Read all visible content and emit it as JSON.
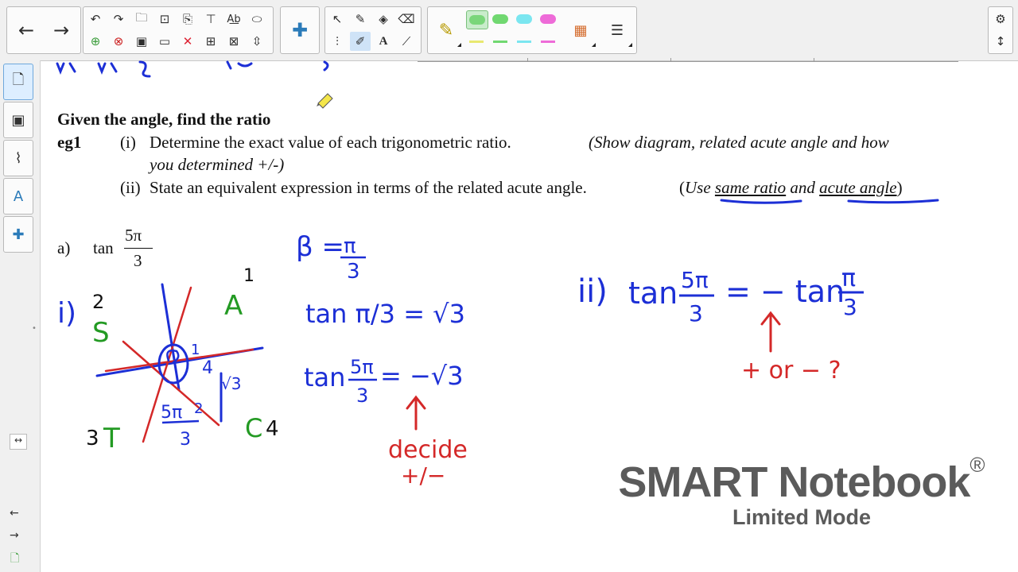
{
  "toolbar": {
    "nav": {
      "back_icon": "left-arrow-icon",
      "forward_icon": "right-arrow-icon"
    },
    "colors": [
      "#7ad67a",
      "#e8e870",
      "#71d871",
      "#7be6f0",
      "#ee6bd8"
    ]
  },
  "problem": {
    "heading": "Given the angle, find the ratio",
    "example_label": "eg1",
    "part_i_num": "(i)",
    "part_i_text": "Determine the exact value of each trigonometric ratio.",
    "part_i_italic": "(Show diagram, related acute angle and how",
    "part_i_italic2": "you determined +/-)",
    "part_ii_num": "(ii)",
    "part_ii_text": "State an equivalent expression in terms of the related acute angle.",
    "part_ii_open": "(",
    "part_ii_use": "Use",
    "part_ii_same_ratio": "same ratio",
    "part_ii_and": "and",
    "part_ii_acute_angle": "acute angle",
    "part_ii_close": ")",
    "part_a_label": "a)",
    "part_a_func": "tan",
    "part_a_num": "5π",
    "part_a_den": "3"
  },
  "watermark": {
    "title": "SMART Notebook",
    "reg": "®",
    "subtitle": "Limited Mode"
  },
  "ink": {
    "quadrant_i": "i)",
    "s": "S",
    "a": "A",
    "t": "T",
    "c": "C",
    "n1": "1",
    "n2": "2",
    "n3": "3",
    "n4": "4",
    "beta": "β =",
    "pi": "π",
    "three": "3",
    "tan_line": "tan π/3 = √3",
    "tan_frac": "tan",
    "five_pi": "5π",
    "eq_neg_root": "= −√3",
    "decide": "decide",
    "plus_minus": "+/−",
    "ii": "ii)",
    "eq_neg_tan": "= − tan",
    "plus_or_minus": "+ or − ?"
  }
}
